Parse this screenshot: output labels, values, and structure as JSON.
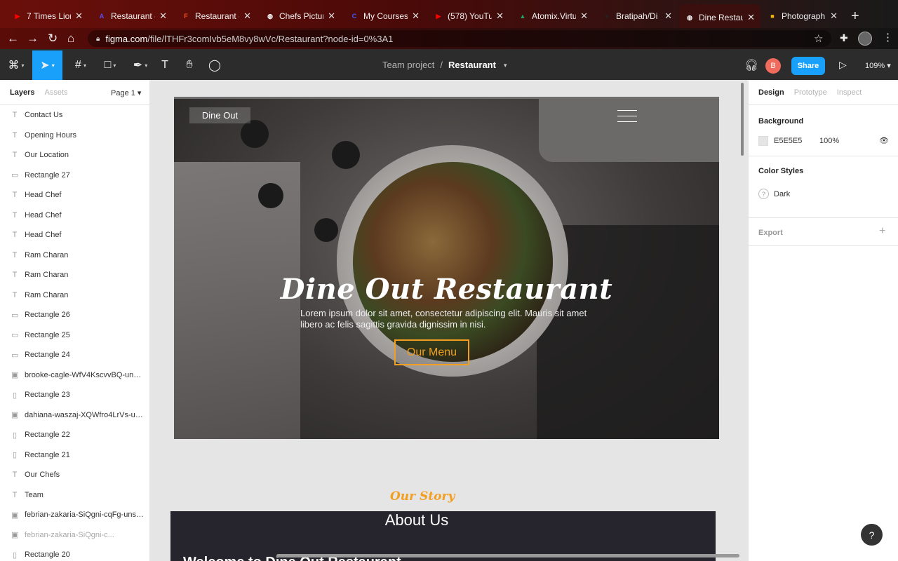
{
  "browser": {
    "tabs": [
      {
        "label": "7 Times Lion",
        "color": "#ff0000",
        "glyph": "▶"
      },
      {
        "label": "Restaurant -",
        "color": "#5b4cf5",
        "glyph": "A"
      },
      {
        "label": "Restaurant -",
        "color": "#f24e1e",
        "glyph": "F"
      },
      {
        "label": "Chefs Pictur",
        "color": "#ffffff",
        "glyph": "◍"
      },
      {
        "label": "My Courses",
        "color": "#3d5afe",
        "glyph": "C"
      },
      {
        "label": "(578) YouTu",
        "color": "#ff0000",
        "glyph": "▶"
      },
      {
        "label": "Atomix.Virtu",
        "color": "#1fa463",
        "glyph": "▲"
      },
      {
        "label": "Bratipah/Di",
        "color": "#222222",
        "glyph": "●"
      },
      {
        "label": "Dine Restau",
        "color": "#ffffff",
        "glyph": "◍"
      },
      {
        "label": "Photograph",
        "color": "#f4b400",
        "glyph": "■"
      }
    ],
    "url_host": "figma.com",
    "url_path": "/file/lTHFr3comIvb5eM8vy8wVc/Restaurant?node-id=0%3A1"
  },
  "toolbar": {
    "team": "Team project",
    "separator": "/",
    "file": "Restaurant",
    "avatar": "B",
    "share": "Share",
    "zoom": "109%"
  },
  "left_panel": {
    "tab_layers": "Layers",
    "tab_assets": "Assets",
    "page": "Page 1",
    "layers": [
      {
        "name": "Contact Us",
        "icon": "T"
      },
      {
        "name": "Opening Hours",
        "icon": "T"
      },
      {
        "name": "Our Location",
        "icon": "T"
      },
      {
        "name": "Rectangle 27",
        "icon": "▭"
      },
      {
        "name": "Head Chef",
        "icon": "T"
      },
      {
        "name": "Head Chef",
        "icon": "T"
      },
      {
        "name": "Head Chef",
        "icon": "T"
      },
      {
        "name": "Ram Charan",
        "icon": "T"
      },
      {
        "name": "Ram Charan",
        "icon": "T"
      },
      {
        "name": "Ram Charan",
        "icon": "T"
      },
      {
        "name": "Rectangle 26",
        "icon": "▭"
      },
      {
        "name": "Rectangle 25",
        "icon": "▭"
      },
      {
        "name": "Rectangle 24",
        "icon": "▭"
      },
      {
        "name": "brooke-cagle-WfV4KscvvBQ-unsp...",
        "icon": "▣"
      },
      {
        "name": "Rectangle 23",
        "icon": "▯"
      },
      {
        "name": "dahiana-waszaj-XQWfro4LrVs-uns...",
        "icon": "▣"
      },
      {
        "name": "Rectangle 22",
        "icon": "▯"
      },
      {
        "name": "Rectangle 21",
        "icon": "▯"
      },
      {
        "name": "Our Chefs",
        "icon": "T"
      },
      {
        "name": "Team",
        "icon": "T"
      },
      {
        "name": "febrian-zakaria-SiQgni-cqFg-unsp...",
        "icon": "▣"
      },
      {
        "name": "febrian-zakaria-SiQgni-c...",
        "icon": "▣",
        "dim": true
      },
      {
        "name": "Rectangle 20",
        "icon": "▯"
      }
    ]
  },
  "canvas": {
    "logo": "Dine Out",
    "hero_title": "Dine Out Restaurant",
    "hero_text": "Lorem ipsum dolor sit amet, consectetur adipiscing elit. Mauris sit amet libero ac felis sagittis gravida dignissim in nisi.",
    "menu_button": "Our Menu",
    "story": "Our Story",
    "about": "About Us",
    "welcome": "Welcome to Dine Out Restaurant"
  },
  "right_panel": {
    "tab_design": "Design",
    "tab_prototype": "Prototype",
    "tab_inspect": "Inspect",
    "background_label": "Background",
    "background_hex": "E5E5E5",
    "background_opacity": "100%",
    "color_styles_label": "Color Styles",
    "color_style_name": "Dark",
    "export_label": "Export"
  },
  "help": "?"
}
